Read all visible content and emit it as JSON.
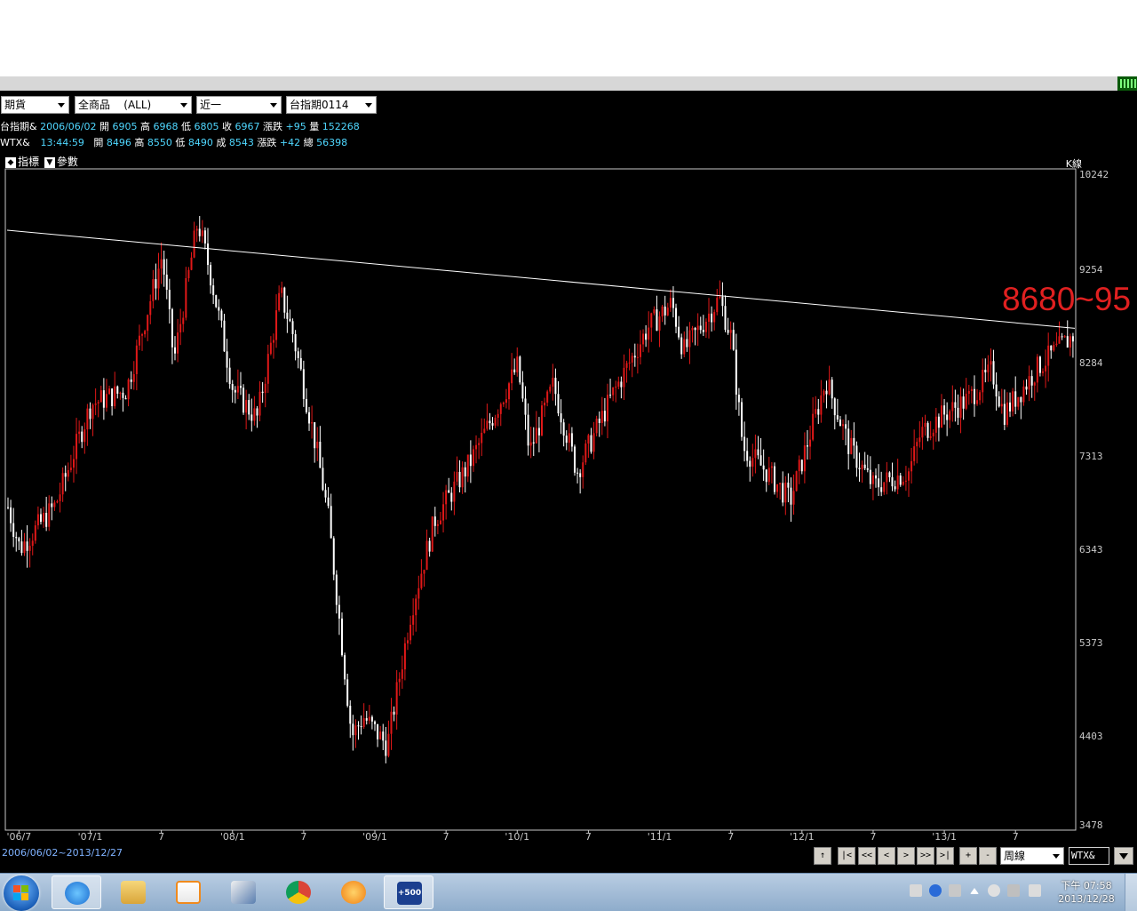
{
  "selectors": {
    "market": "期貨",
    "product": "全商品    (ALL)",
    "range": "近一",
    "contract": "台指期0114"
  },
  "quote1": {
    "name": "台指期&",
    "date": "2006/06/02",
    "open_lbl": "開",
    "open": "6905",
    "high_lbl": "高",
    "high": "6968",
    "low_lbl": "低",
    "low": "6805",
    "close_lbl": "收",
    "close": "6967",
    "chg_lbl": "漲跌",
    "chg": "+95",
    "vol_lbl": "量",
    "vol": "152268"
  },
  "quote2": {
    "name": "WTX&",
    "time": "13:44:59",
    "open_lbl": "開",
    "open": "8496",
    "high_lbl": "高",
    "high": "8550",
    "low_lbl": "低",
    "low": "8490",
    "last_lbl": "成",
    "last": "8543",
    "chg_lbl": "漲跌",
    "chg": "+42",
    "total_lbl": "總",
    "total": "56398"
  },
  "toolbar": {
    "indicator": "指標",
    "params": "參數",
    "kline": "K線"
  },
  "annotation": "8680~95",
  "date_range": "2006/06/02~2013/12/27",
  "nav_buttons": [
    "↑",
    "|<",
    "<<",
    "<",
    ">",
    ">>",
    ">|",
    "+",
    "-"
  ],
  "period": "周線",
  "symbol": "WTX&",
  "clock": {
    "time": "下午 07:58",
    "date": "2013/12/28"
  },
  "colors": {
    "up": "#e01818",
    "down": "#ffffff",
    "price_axis": "#c8c8c8",
    "quote_value": "#4fd7ff",
    "annotation": "#e02020"
  },
  "chart_data": {
    "type": "candlestick",
    "y_ticks": [
      10242,
      9254,
      8284,
      7313,
      6343,
      5373,
      4403,
      3478
    ],
    "x_ticks": [
      "'06/7",
      "'07/1",
      "7",
      "'08/1",
      "7",
      "'09/1",
      "7",
      "'10/1",
      "7",
      "'11/1",
      "7",
      "'12/1",
      "7",
      "'13/1",
      "7"
    ],
    "ylim": [
      3478,
      10242
    ],
    "xlim": [
      "2006-06",
      "2013-12"
    ],
    "trendline": [
      {
        "x": "2006-06",
        "y": 9660
      },
      {
        "x": "2013-12",
        "y": 8640
      }
    ],
    "anchors": [
      {
        "x": "2006-06",
        "y": 6780
      },
      {
        "x": "2006-07",
        "y": 6350
      },
      {
        "x": "2006-10",
        "y": 6800
      },
      {
        "x": "2007-01",
        "y": 7850
      },
      {
        "x": "2007-04",
        "y": 8000
      },
      {
        "x": "2007-07",
        "y": 9400
      },
      {
        "x": "2007-08",
        "y": 8300
      },
      {
        "x": "2007-10",
        "y": 9750
      },
      {
        "x": "2007-11",
        "y": 9250
      },
      {
        "x": "2008-01",
        "y": 8000
      },
      {
        "x": "2008-03",
        "y": 7700
      },
      {
        "x": "2008-05",
        "y": 9000
      },
      {
        "x": "2008-06",
        "y": 8600
      },
      {
        "x": "2008-08",
        "y": 7400
      },
      {
        "x": "2008-09",
        "y": 6700
      },
      {
        "x": "2008-11",
        "y": 4400
      },
      {
        "x": "2008-12",
        "y": 4600
      },
      {
        "x": "2009-02",
        "y": 4300
      },
      {
        "x": "2009-04",
        "y": 5700
      },
      {
        "x": "2009-06",
        "y": 6650
      },
      {
        "x": "2009-09",
        "y": 7250
      },
      {
        "x": "2010-01",
        "y": 8250
      },
      {
        "x": "2010-02",
        "y": 7350
      },
      {
        "x": "2010-04",
        "y": 8050
      },
      {
        "x": "2010-06",
        "y": 7150
      },
      {
        "x": "2010-09",
        "y": 7950
      },
      {
        "x": "2010-12",
        "y": 8650
      },
      {
        "x": "2011-02",
        "y": 8900
      },
      {
        "x": "2011-03",
        "y": 8400
      },
      {
        "x": "2011-06",
        "y": 8950
      },
      {
        "x": "2011-07",
        "y": 8550
      },
      {
        "x": "2011-08",
        "y": 7400
      },
      {
        "x": "2011-10",
        "y": 7150
      },
      {
        "x": "2011-12",
        "y": 6850
      },
      {
        "x": "2012-03",
        "y": 8100
      },
      {
        "x": "2012-05",
        "y": 7400
      },
      {
        "x": "2012-07",
        "y": 7000
      },
      {
        "x": "2012-10",
        "y": 7150
      },
      {
        "x": "2012-11",
        "y": 7550
      },
      {
        "x": "2013-01",
        "y": 7750
      },
      {
        "x": "2013-03",
        "y": 7900
      },
      {
        "x": "2013-05",
        "y": 8200
      },
      {
        "x": "2013-06",
        "y": 7750
      },
      {
        "x": "2013-09",
        "y": 8250
      },
      {
        "x": "2013-12",
        "y": 8580
      }
    ]
  }
}
